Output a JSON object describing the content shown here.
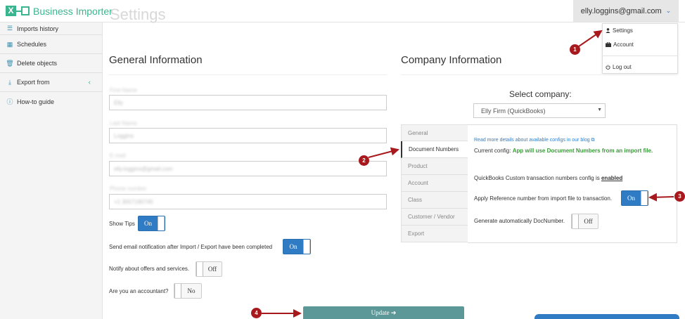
{
  "header": {
    "logo_glyph": "X",
    "app_name": "Business Importer",
    "page_title": "Settings",
    "user_email": "elly.loggins@gmail.com",
    "chevron_glyph": "⌄"
  },
  "user_dropdown": {
    "items": [
      {
        "label": "Settings",
        "icon": "user-icon"
      },
      {
        "label": "Account",
        "icon": "briefcase-icon"
      },
      {
        "label": "Log out",
        "icon": "power-icon"
      }
    ]
  },
  "sidebar": {
    "items": [
      {
        "label": "Imports history",
        "icon": "list-icon",
        "glyph": "☰"
      },
      {
        "label": "Schedules",
        "icon": "calendar-icon",
        "glyph": "▦"
      },
      {
        "label": "Delete objects",
        "icon": "trash-icon",
        "glyph": "🗑"
      },
      {
        "label": "Export from",
        "icon": "download-icon",
        "glyph": "⤓"
      },
      {
        "label": "How-to guide",
        "icon": "info-icon",
        "glyph": "ⓘ"
      }
    ],
    "collapse_glyph": "‹"
  },
  "general_info": {
    "heading": "General Information",
    "fields": [
      {
        "label": "First Name",
        "value": "Elly"
      },
      {
        "label": "Last Name",
        "value": "Loggins"
      },
      {
        "label": "E-mail",
        "value": "elly.loggins@gmail.com"
      },
      {
        "label": "Phone number",
        "value": "+1 3057180745"
      }
    ],
    "show_tips_label": "Show Tips",
    "show_tips_state": "On",
    "email_notif_label": "Send email notification after Import / Export have been completed",
    "email_notif_state": "On",
    "offers_label": "Notify about offers and services.",
    "offers_state": "Off",
    "accountant_label": "Are you an accountant?",
    "accountant_state": "No",
    "update_label": "Update ➔"
  },
  "company_info": {
    "heading": "Company Information",
    "select_label": "Select company:",
    "selected_company": "Elly Firm (QuickBooks)",
    "caret_glyph": "▼",
    "tabs": [
      "General",
      "Document Numbers",
      "Product",
      "Account",
      "Class",
      "Customer / Vendor",
      "Export"
    ],
    "active_tab": "Document Numbers",
    "blog_link": "Read more details about available configs in our blog ⧉",
    "current_config_prefix": "Current config:",
    "current_config_value": "App will use Document Numbers from an import file.",
    "custom_config_prefix": "QuickBooks Custom transaction numbers config is",
    "custom_config_value": "enabled",
    "apply_ref_label": "Apply Reference number from import file to transaction.",
    "apply_ref_state": "On",
    "auto_docnum_label": "Generate automatically DocNumber.",
    "auto_docnum_state": "Off"
  },
  "annotations": {
    "badges": [
      "1",
      "2",
      "3",
      "4"
    ],
    "arrow_color": "#a8191e"
  },
  "colors": {
    "brand": "#3bb58f",
    "toggle_on": "#2f7bc4",
    "update_button": "#5d9898"
  }
}
